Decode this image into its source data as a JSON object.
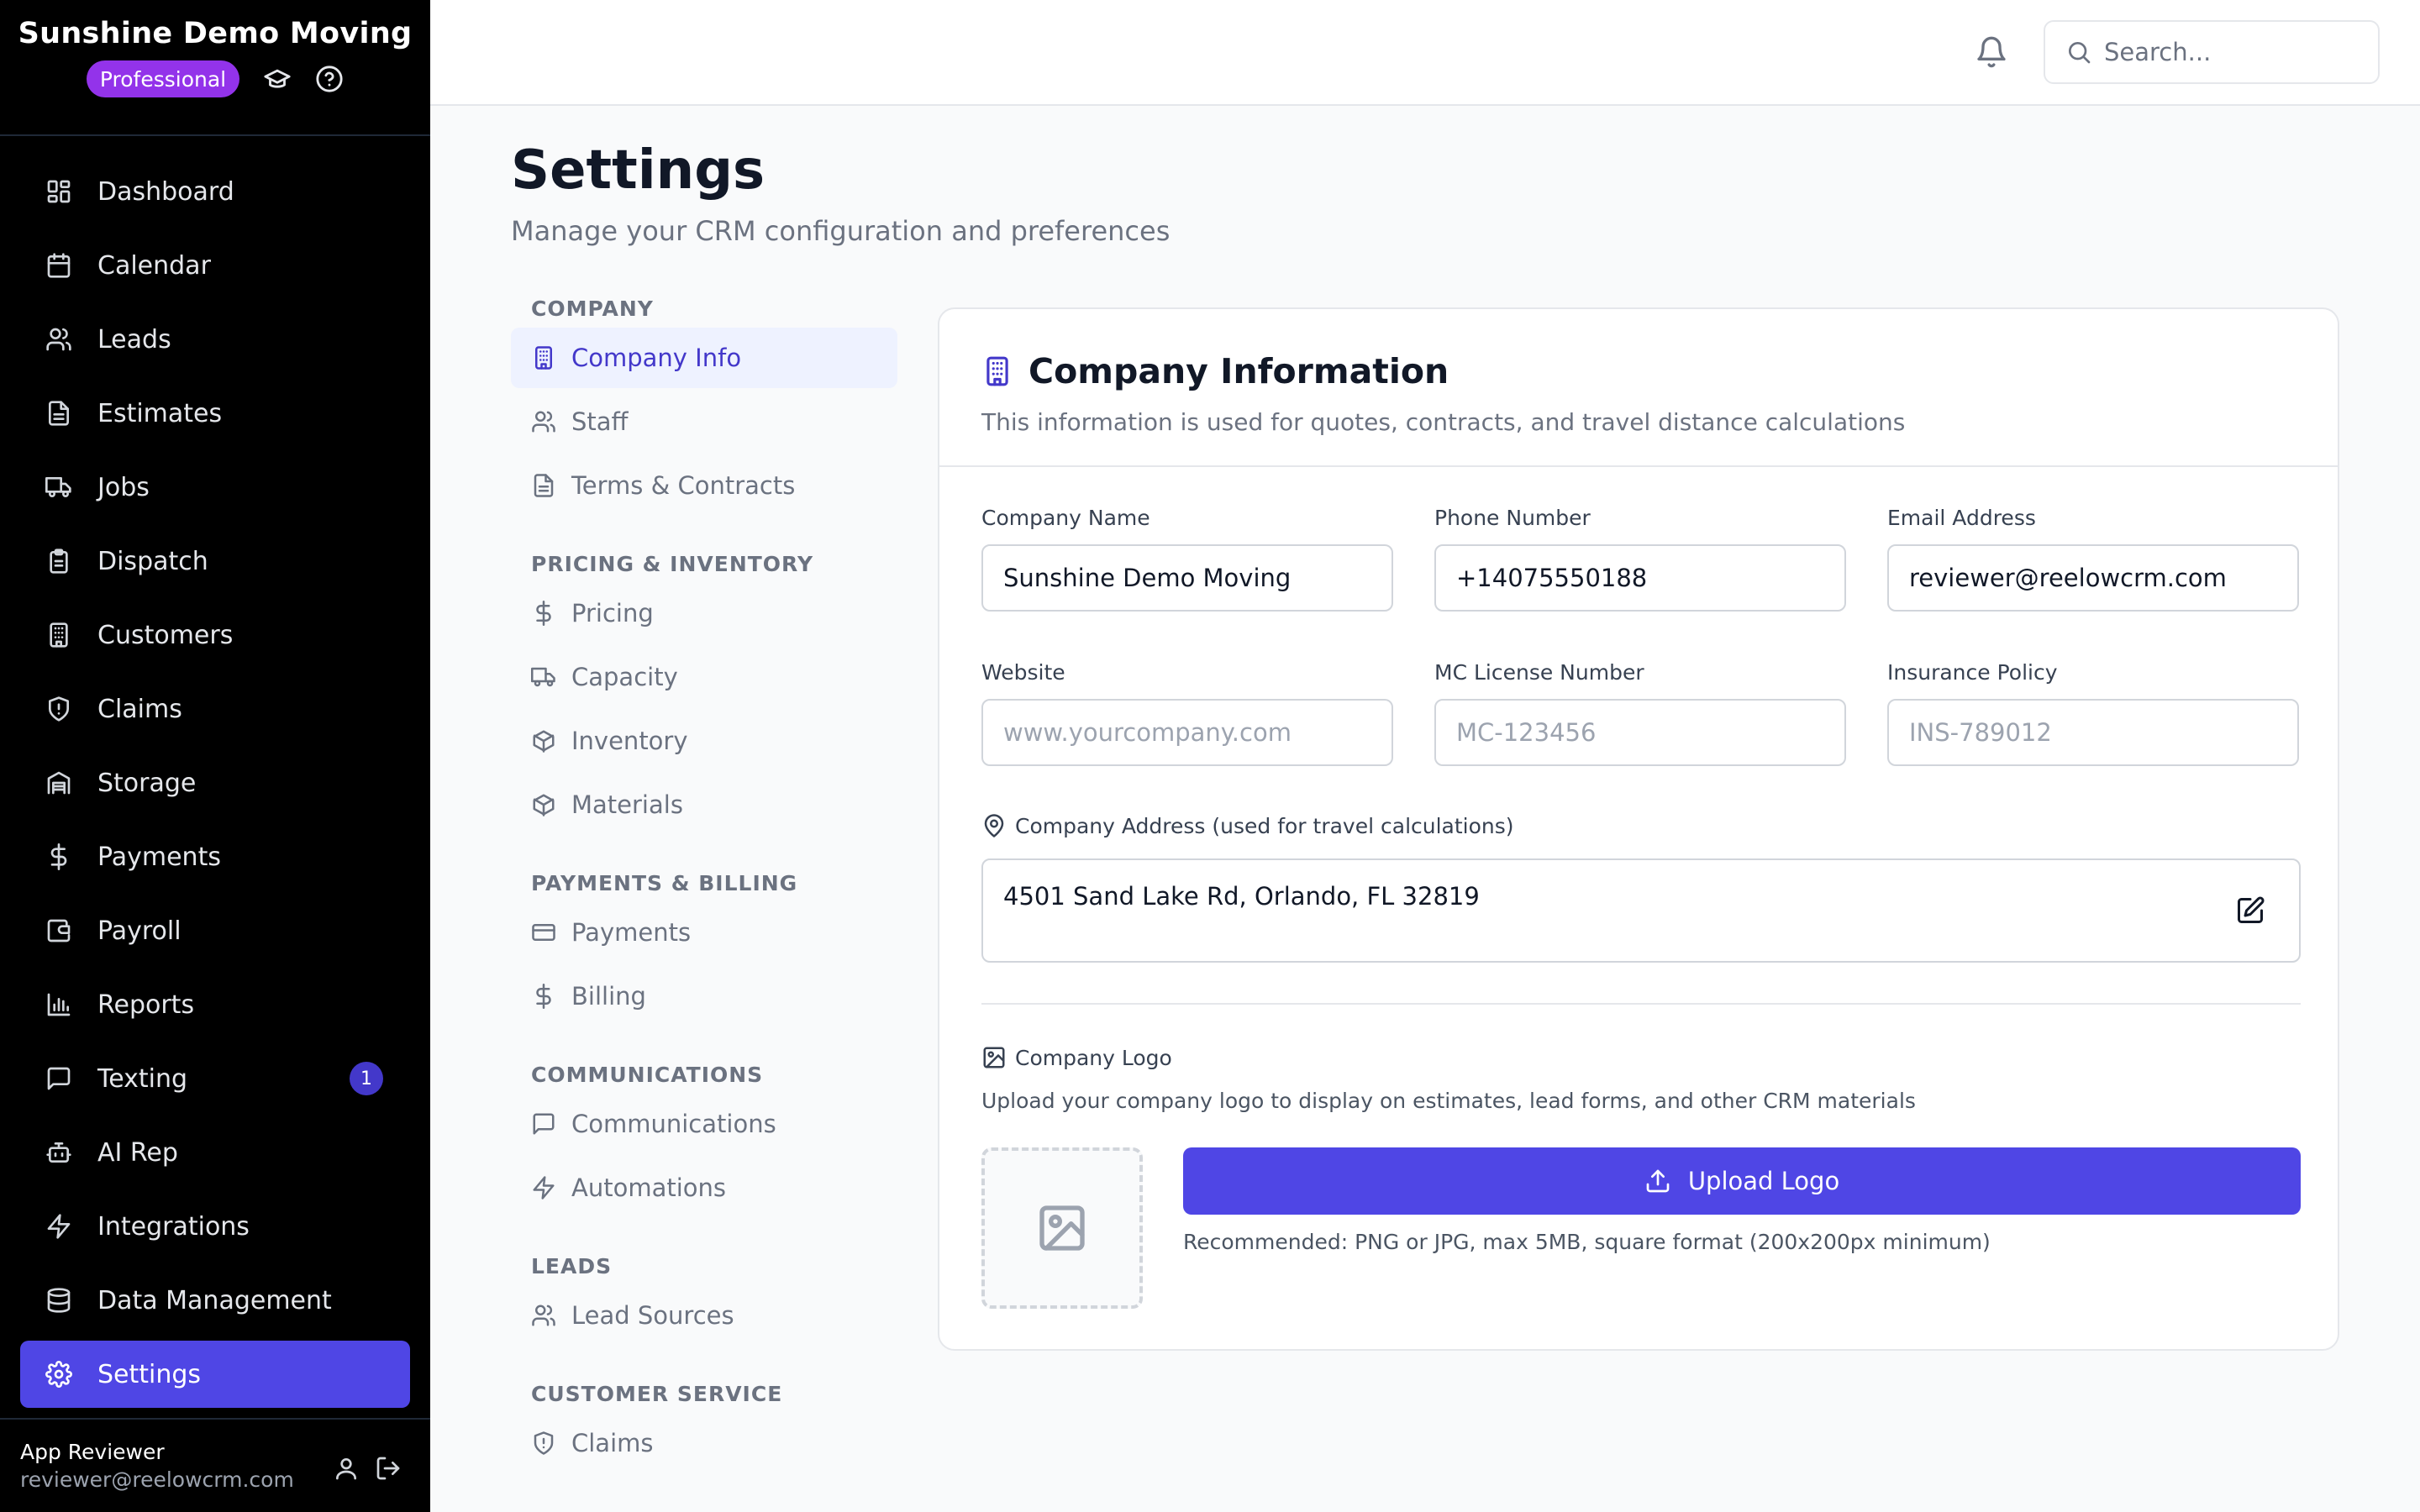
{
  "app": {
    "name": "Sunshine Demo Moving",
    "plan": "Professional"
  },
  "sidebar": {
    "items": [
      {
        "label": "Dashboard",
        "icon": "dashboard-icon"
      },
      {
        "label": "Calendar",
        "icon": "calendar-icon"
      },
      {
        "label": "Leads",
        "icon": "users-icon"
      },
      {
        "label": "Estimates",
        "icon": "file-icon"
      },
      {
        "label": "Jobs",
        "icon": "truck-icon"
      },
      {
        "label": "Dispatch",
        "icon": "clipboard-icon"
      },
      {
        "label": "Customers",
        "icon": "building-icon"
      },
      {
        "label": "Claims",
        "icon": "shield-icon"
      },
      {
        "label": "Storage",
        "icon": "warehouse-icon"
      },
      {
        "label": "Payments",
        "icon": "dollar-icon"
      },
      {
        "label": "Payroll",
        "icon": "wallet-icon"
      },
      {
        "label": "Reports",
        "icon": "bar-chart-icon"
      },
      {
        "label": "Texting",
        "icon": "message-icon",
        "badge": "1"
      },
      {
        "label": "AI Rep",
        "icon": "bot-icon"
      },
      {
        "label": "Integrations",
        "icon": "zap-icon"
      },
      {
        "label": "Data Management",
        "icon": "database-icon"
      },
      {
        "label": "Settings",
        "icon": "gear-icon",
        "active": true
      }
    ]
  },
  "user": {
    "name": "App Reviewer",
    "email": "reviewer@reelowcrm.com"
  },
  "topbar": {
    "search_placeholder": "Search..."
  },
  "page": {
    "title": "Settings",
    "subtitle": "Manage your CRM configuration and preferences"
  },
  "settings_nav": {
    "sections": [
      {
        "title": "COMPANY",
        "items": [
          "Company Info",
          "Staff",
          "Terms & Contracts"
        ]
      },
      {
        "title": "PRICING & INVENTORY",
        "items": [
          "Pricing",
          "Capacity",
          "Inventory",
          "Materials"
        ]
      },
      {
        "title": "PAYMENTS & BILLING",
        "items": [
          "Payments",
          "Billing"
        ]
      },
      {
        "title": "COMMUNICATIONS",
        "items": [
          "Communications",
          "Automations"
        ]
      },
      {
        "title": "LEADS",
        "items": [
          "Lead Sources"
        ]
      },
      {
        "title": "CUSTOMER SERVICE",
        "items": [
          "Claims"
        ]
      }
    ],
    "active": "Company Info"
  },
  "card": {
    "title": "Company Information",
    "description": "This information is used for quotes, contracts, and travel distance calculations",
    "fields": {
      "company_name": {
        "label": "Company Name",
        "value": "Sunshine Demo Moving",
        "placeholder": ""
      },
      "phone": {
        "label": "Phone Number",
        "value": "+14075550188",
        "placeholder": ""
      },
      "email": {
        "label": "Email Address",
        "value": "reviewer@reelowcrm.com",
        "placeholder": ""
      },
      "website": {
        "label": "Website",
        "value": "",
        "placeholder": "www.yourcompany.com"
      },
      "mc_license": {
        "label": "MC License Number",
        "value": "",
        "placeholder": "MC-123456"
      },
      "insurance": {
        "label": "Insurance Policy",
        "value": "",
        "placeholder": "INS-789012"
      }
    },
    "address": {
      "label": "Company Address (used for travel calculations)",
      "value": "4501 Sand Lake Rd, Orlando, FL 32819"
    },
    "logo": {
      "label": "Company Logo",
      "description": "Upload your company logo to display on estimates, lead forms, and other CRM materials",
      "button": "Upload Logo",
      "hint": "Recommended: PNG or JPG, max 5MB, square format (200x200px minimum)"
    }
  },
  "colors": {
    "accent": "#4f46e5",
    "plan_badge": "#9333ea",
    "sidebar_bg": "#000000"
  }
}
